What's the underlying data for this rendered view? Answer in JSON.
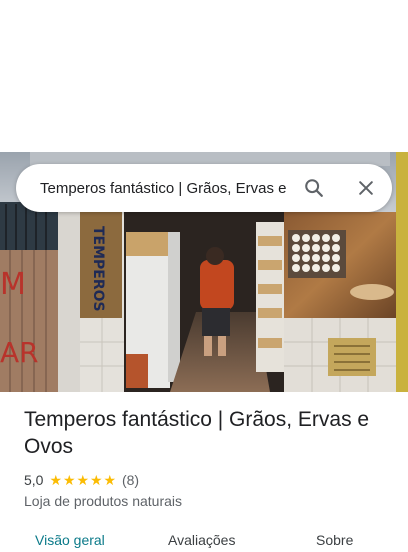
{
  "search": {
    "query": "Temperos fantástico | Grãos, Ervas e Ovos"
  },
  "place": {
    "title": "Temperos fantástico | Grãos, Ervas e Ovos",
    "rating": "5,0",
    "stars": 5,
    "review_count": "(8)",
    "category": "Loja de produtos naturais"
  },
  "photo": {
    "sign_text": "TEMPEROS",
    "wall_text_left": "M",
    "wall_text_left2": "AR"
  },
  "tabs": [
    {
      "label": "Visão geral",
      "active": true
    },
    {
      "label": "Avaliações",
      "active": false
    },
    {
      "label": "Sobre",
      "active": false
    }
  ],
  "colors": {
    "accent": "#0b7a89",
    "star": "#fbbc04"
  }
}
